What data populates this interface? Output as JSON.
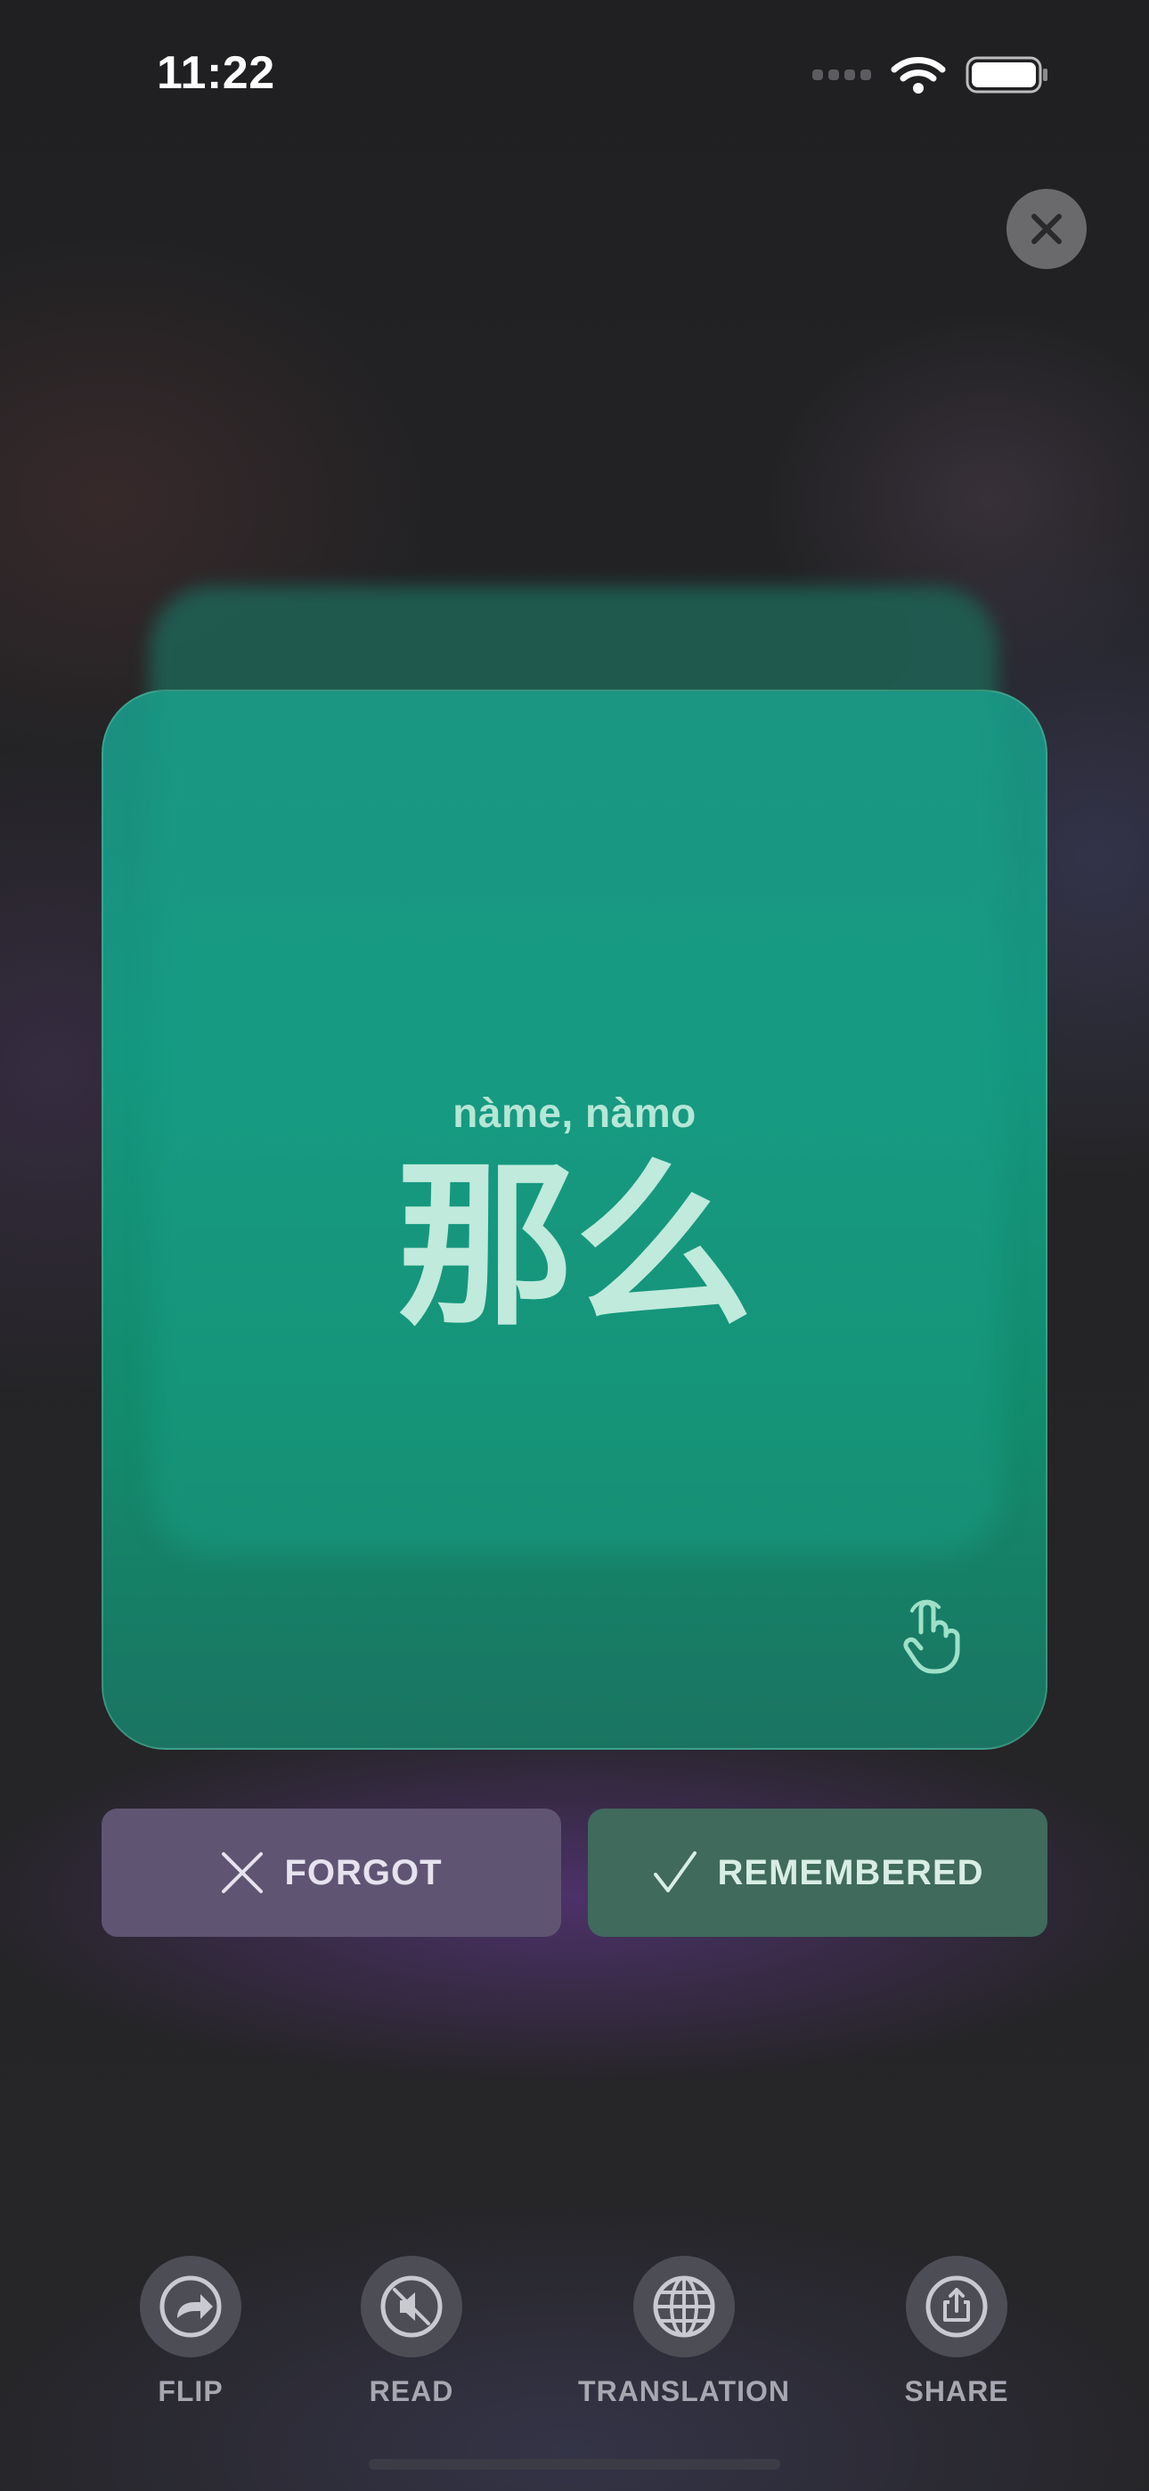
{
  "status_bar": {
    "time": "11:22"
  },
  "card": {
    "pinyin": "nàme, nàmo",
    "hanzi": "那么",
    "colors": {
      "card": "#14977f",
      "text": "#bfeadc"
    }
  },
  "actions": {
    "forgot_label": "FORGOT",
    "remembered_label": "REMEMBERED"
  },
  "toolbar": {
    "items": [
      {
        "label": "FLIP",
        "icon": "flip-arrow-icon"
      },
      {
        "label": "READ",
        "icon": "speaker-muted-icon"
      },
      {
        "label": "TRANSLATION",
        "icon": "globe-icon"
      },
      {
        "label": "SHARE",
        "icon": "share-icon"
      }
    ]
  }
}
